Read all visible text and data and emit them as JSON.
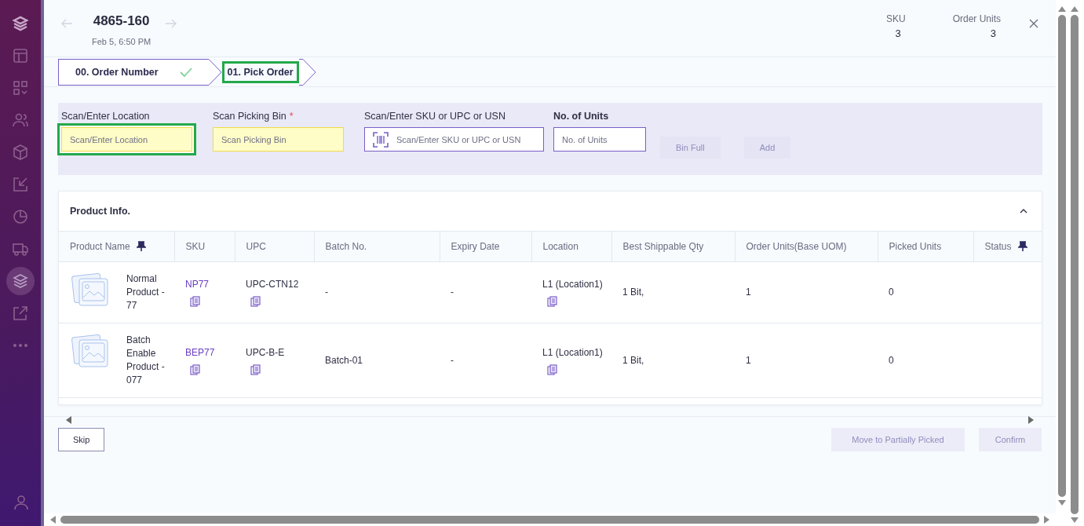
{
  "sidebar": {
    "items": [
      {
        "selected": false
      },
      {
        "selected": false
      },
      {
        "selected": false
      },
      {
        "selected": false
      },
      {
        "selected": false
      },
      {
        "selected": false
      },
      {
        "selected": false
      },
      {
        "selected": false
      },
      {
        "selected": true
      },
      {
        "selected": false
      },
      {
        "selected": false
      }
    ]
  },
  "header": {
    "order_number": "4865-160",
    "date": "Feb 5, 6:50 PM",
    "stats": [
      {
        "label": "SKU",
        "value": "3"
      },
      {
        "label": "Order Units",
        "value": "3"
      }
    ]
  },
  "steps": [
    {
      "label": "00. Order Number",
      "completed": true,
      "selected": false
    },
    {
      "label": "01. Pick Order",
      "completed": false,
      "selected": true
    }
  ],
  "form": {
    "required_mark": "*",
    "fields": [
      {
        "kind": "bin",
        "label": "Scan/Enter Location",
        "placeholder": "Scan/Enter Location",
        "required": false,
        "highlighted": true
      },
      {
        "kind": "bin",
        "label": "Scan Picking Bin",
        "placeholder": "Scan Picking Bin",
        "required": true,
        "highlighted": false
      },
      {
        "kind": "scan",
        "label": "Scan/Enter SKU or UPC or USN",
        "placeholder": "Scan/Enter SKU or UPC or USN",
        "required": false,
        "highlighted": false
      },
      {
        "kind": "number",
        "label": "No. of Units",
        "placeholder": "No. of Units",
        "required": false,
        "highlighted": false
      }
    ],
    "buttons": [
      {
        "label": "Bin Full",
        "disabled": true
      },
      {
        "label": "Add",
        "disabled": true
      }
    ]
  },
  "product_info": {
    "title": "Product Info.",
    "expanded": true,
    "columns": [
      {
        "label": "Product Name",
        "pinned": true
      },
      {
        "label": "SKU",
        "pinned": false
      },
      {
        "label": "UPC",
        "pinned": false
      },
      {
        "label": "Batch No.",
        "pinned": false
      },
      {
        "label": "Expiry Date",
        "pinned": false
      },
      {
        "label": "Location",
        "pinned": false
      },
      {
        "label": "Best Shippable Qty",
        "pinned": false
      },
      {
        "label": "Order Units(Base UOM)",
        "pinned": false
      },
      {
        "label": "Picked Units",
        "pinned": false
      },
      {
        "label": "Status",
        "pinned": true
      }
    ],
    "rows": [
      {
        "product_name": "Normal Product - 77",
        "sku": "NP77",
        "upc": "UPC-CTN12",
        "batch_no": "-",
        "expiry_date": "-",
        "location": "L1 (Location1)",
        "best_shippable_qty": "1 Bit,",
        "order_units": "1",
        "picked_units": "0"
      },
      {
        "product_name": "Batch Enable Product - 077",
        "sku": "BEP77",
        "upc": "UPC-B-E",
        "batch_no": "Batch-01",
        "expiry_date": "-",
        "location": "L1 (Location1)",
        "best_shippable_qty": "1 Bit,",
        "order_units": "1",
        "picked_units": "0"
      }
    ]
  },
  "footer": {
    "buttons": [
      {
        "label": "Skip",
        "disabled": false
      },
      {
        "label": "Move to Partially Picked",
        "disabled": true
      },
      {
        "label": "Confirm",
        "disabled": true
      }
    ]
  }
}
